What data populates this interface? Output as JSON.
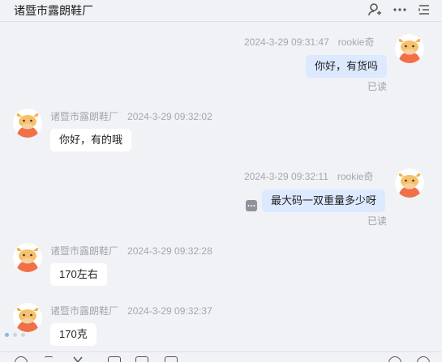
{
  "header": {
    "title": "诸暨市露朗鞋厂",
    "icons": [
      "add-user-icon",
      "more-icon",
      "menu-icon"
    ]
  },
  "messages": [
    {
      "direction": "out",
      "time": "2024-3-29 09:31:47",
      "sender": "rookie奇",
      "text": "你好，有货吗",
      "status": "已读"
    },
    {
      "direction": "in",
      "sender": "诸暨市露朗鞋厂",
      "time": "2024-3-29 09:32:02",
      "text": "你好，有的哦"
    },
    {
      "direction": "out",
      "time": "2024-3-29 09:32:11",
      "sender": "rookie奇",
      "text": "最大码一双重量多少呀",
      "status": "已读"
    },
    {
      "direction": "in",
      "sender": "诸暨市露朗鞋厂",
      "time": "2024-3-29 09:32:28",
      "text": "170左右"
    },
    {
      "direction": "in",
      "sender": "诸暨市露朗鞋厂",
      "time": "2024-3-29 09:32:37",
      "text": "170克"
    }
  ],
  "colors": {
    "background": "#f1f2f6",
    "incoming_bubble": "#ffffff",
    "outgoing_bubble": "#dde9ff",
    "meta_text": "#a4a7ad"
  }
}
